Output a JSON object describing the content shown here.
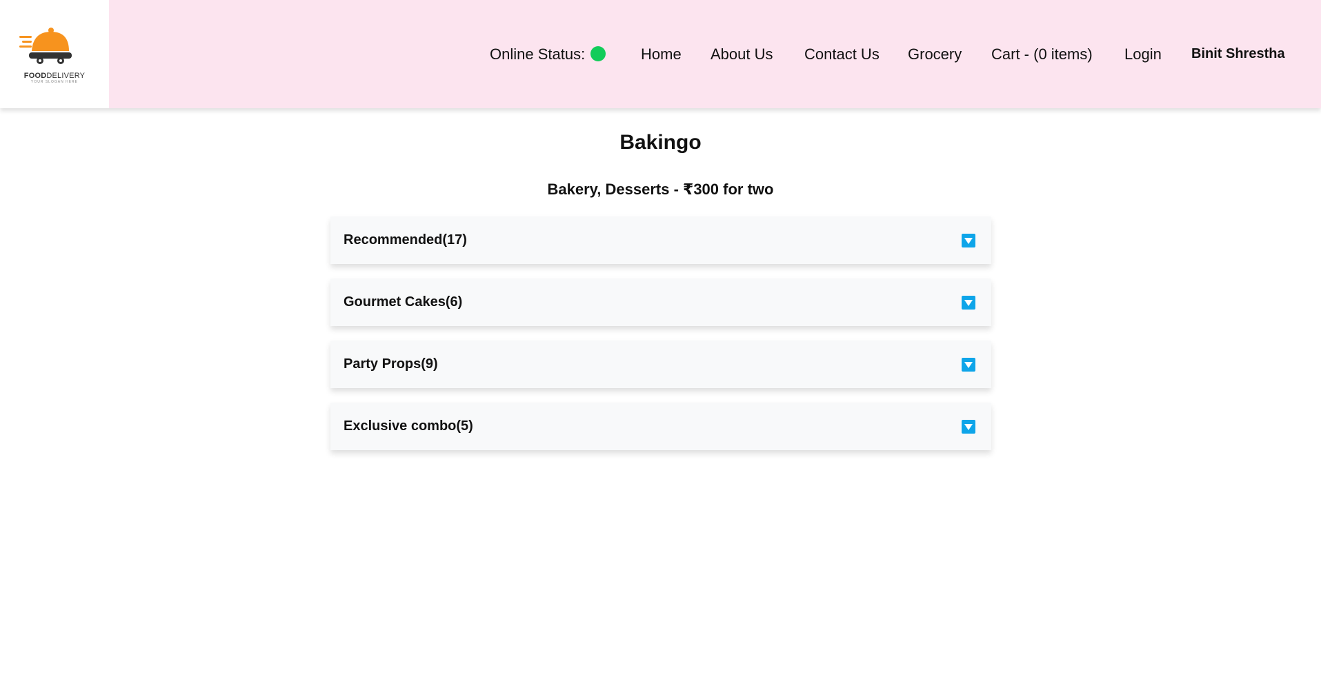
{
  "brand": {
    "name_bold": "FOOD",
    "name_light": "DELIVERY",
    "slogan": "YOUR SLOGAN HERE",
    "colors": {
      "orange": "#f7931e",
      "dark": "#333333"
    }
  },
  "nav": {
    "online_status_label": "Online Status:",
    "online_status_color": "#12cc5a",
    "home": "Home",
    "about": "About Us",
    "contact": "Contact Us",
    "grocery": "Grocery",
    "cart": "Cart - (0 items)",
    "login": "Login",
    "user": "Binit Shrestha"
  },
  "restaurant": {
    "name": "Bakingo",
    "info": "Bakery, Desserts - ₹300 for two"
  },
  "categories": [
    {
      "label": "Recommended(17)",
      "icon": "chevron-down-icon"
    },
    {
      "label": "Gourmet Cakes(6)",
      "icon": "chevron-down-icon"
    },
    {
      "label": "Party Props(9)",
      "icon": "chevron-down-icon"
    },
    {
      "label": "Exclusive combo(5)",
      "icon": "chevron-down-icon"
    }
  ],
  "colors": {
    "header_bg": "#fce4ef",
    "accordion_bg": "#f8f9fa",
    "icon_accent": "#0ea5e9"
  }
}
